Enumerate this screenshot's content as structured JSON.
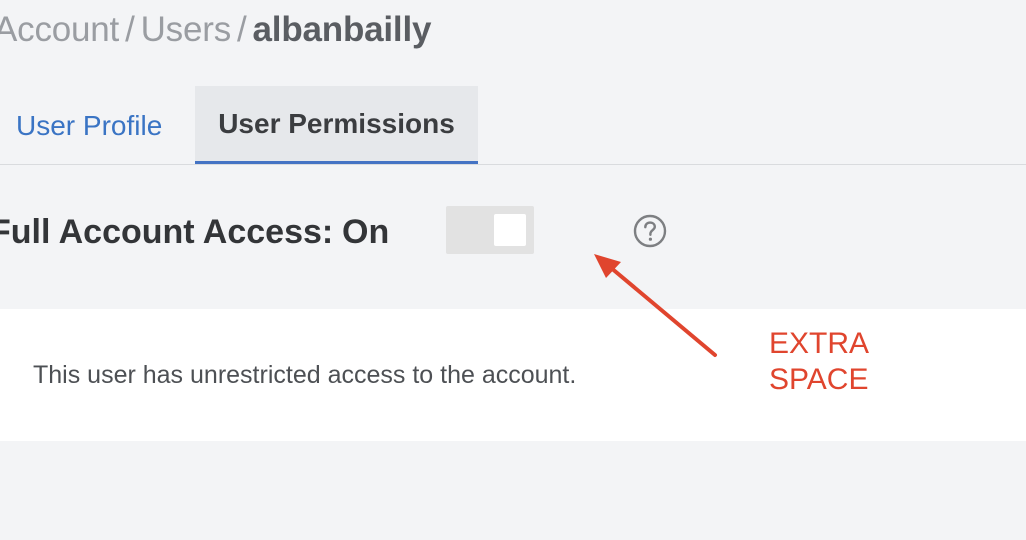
{
  "breadcrumb": {
    "items": [
      "Account",
      "Users"
    ],
    "separator": "/",
    "current": "albanbailly"
  },
  "tabs": [
    {
      "label": "User Profile",
      "active": false
    },
    {
      "label": "User Permissions",
      "active": true
    }
  ],
  "access": {
    "label": "Full Account Access:",
    "value": "On",
    "toggle_on": true,
    "help_icon": "question-circle-icon"
  },
  "info": {
    "text": "This user has unrestricted access to the account."
  },
  "annotation": {
    "line1": "EXTRA",
    "line2": "SPACE",
    "color": "#e0452e"
  },
  "colors": {
    "background": "#f3f4f6",
    "link_blue": "#3a74c4",
    "active_tab_border": "#4473c4",
    "active_tab_bg": "#e6e8eb"
  }
}
